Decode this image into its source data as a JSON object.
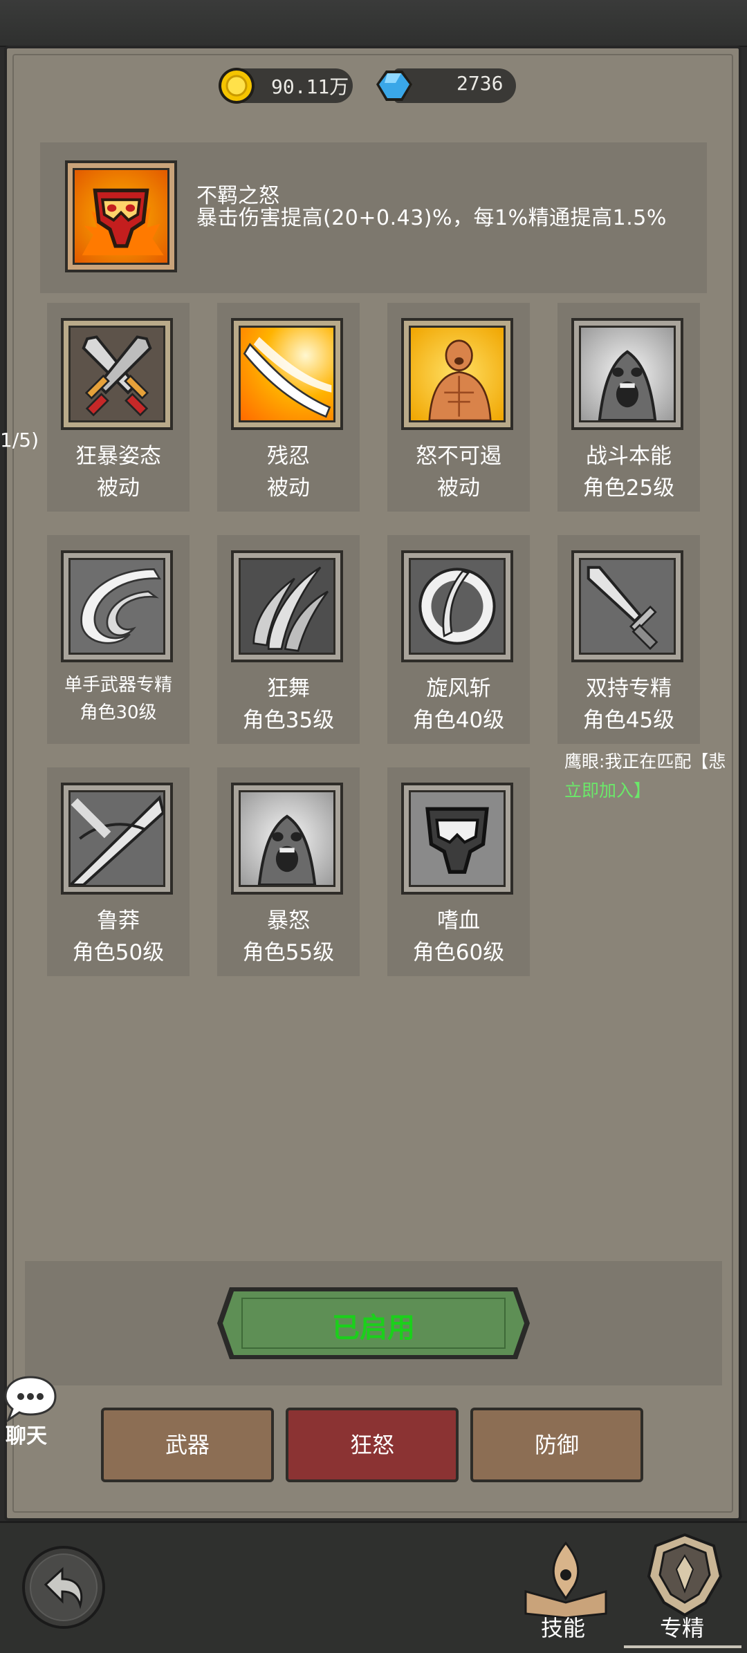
{
  "currency": {
    "gold": "90.11万",
    "gems": "2736"
  },
  "detail": {
    "title": "不羁之怒",
    "description": "暴击伤害提高(20+0.43)%，每1%精通提高1.5%"
  },
  "side_label": "1/5)",
  "skills": [
    {
      "name": "狂暴姿态",
      "req": "被动",
      "icon": "crossed-swords-icon",
      "active": true
    },
    {
      "name": "残忍",
      "req": "被动",
      "icon": "slash-burst-icon",
      "active": true
    },
    {
      "name": "怒不可遏",
      "req": "被动",
      "icon": "raging-man-icon",
      "active": true
    },
    {
      "name": "战斗本能",
      "req": "角色25级",
      "icon": "screaming-face-icon",
      "active": false
    },
    {
      "name": "单手武器专精",
      "req": "角色30级",
      "icon": "whirl-icon",
      "active": false
    },
    {
      "name": "狂舞",
      "req": "角色35级",
      "icon": "claw-icon",
      "active": false
    },
    {
      "name": "旋风斩",
      "req": "角色40级",
      "icon": "whirlwind-blade-icon",
      "active": false
    },
    {
      "name": "双持专精",
      "req": "角色45级",
      "icon": "dagger-icon",
      "active": false
    },
    {
      "name": "鲁莽",
      "req": "角色50级",
      "icon": "broad-sword-icon",
      "active": false
    },
    {
      "name": "暴怒",
      "req": "角色55级",
      "icon": "screaming-face-icon",
      "active": false
    },
    {
      "name": "嗜血",
      "req": "角色60级",
      "icon": "blood-mask-icon",
      "active": false
    }
  ],
  "chat_feed": {
    "message": "鹰眼:我正在匹配【悲",
    "join_link": "立即加入】"
  },
  "enabled_button": "已启用",
  "categories": [
    "武器",
    "狂怒",
    "防御"
  ],
  "selected_category": "狂怒",
  "chat_button": "聊天",
  "nav": {
    "skills": "技能",
    "specialization": "专精"
  },
  "colors": {
    "gold": "#f5c400",
    "gem": "#3aa7e8",
    "enabled_green": "#1bd01b",
    "tab_brown": "#8c6e54",
    "tab_selected_red": "#8b3333",
    "chat_join_green": "#6be86a"
  }
}
